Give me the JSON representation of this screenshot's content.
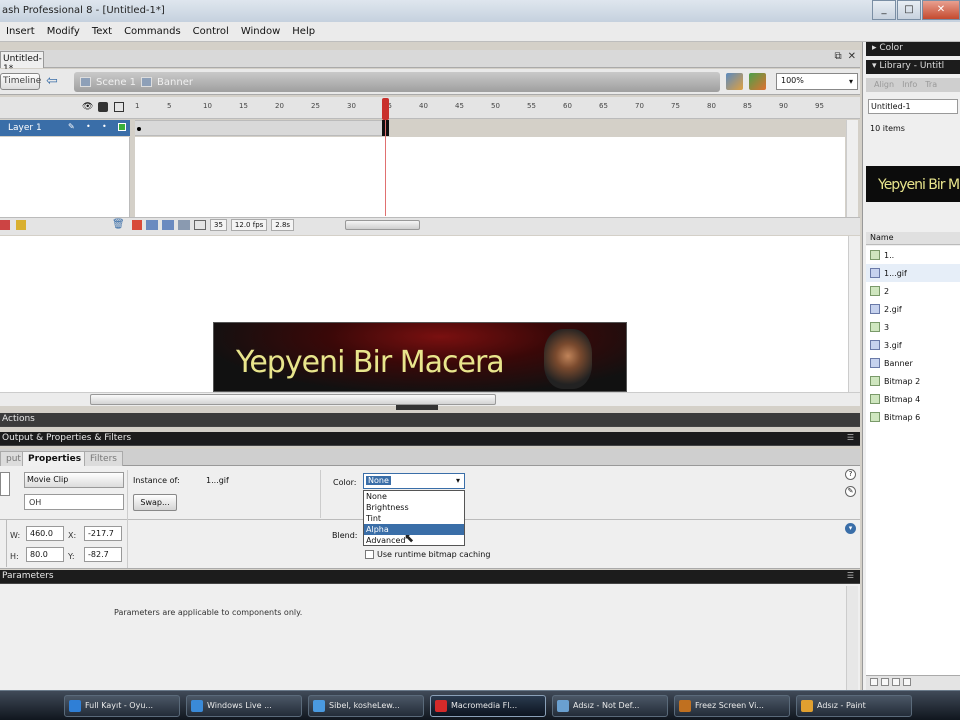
{
  "window": {
    "title": "ash Professional 8 - [Untitled-1*]"
  },
  "menu": [
    "Insert",
    "Modify",
    "Text",
    "Commands",
    "Control",
    "Window",
    "Help"
  ],
  "document": {
    "tab": "Untitled-1*",
    "timeline_button": "Timeline",
    "breadcrumb": [
      "Scene 1",
      "Banner"
    ],
    "zoom": "100%"
  },
  "timeline": {
    "ruler": [
      "1",
      "5",
      "10",
      "15",
      "20",
      "25",
      "30",
      "35",
      "40",
      "45",
      "50",
      "55",
      "60",
      "65",
      "70",
      "75",
      "80",
      "85",
      "90",
      "95"
    ],
    "layer": "Layer 1",
    "current_frame": "35",
    "frame_rate": "12.0 fps",
    "elapsed": "2.8s"
  },
  "stage": {
    "banner_text": "Yepyeni Bir Macera"
  },
  "panels": {
    "actions": "Actions",
    "properties_group": "Output & Properties & Filters",
    "parameters": "Parameters"
  },
  "properties": {
    "tabs": [
      "put",
      "Properties",
      "Filters"
    ],
    "symbol_type": "Movie Clip",
    "instance_name": "OH",
    "instance_of_label": "Instance of:",
    "instance_of_value": "1...gif",
    "swap_label": "Swap...",
    "w_label": "W:",
    "w": "460.0",
    "h_label": "H:",
    "h": "80.0",
    "x_label": "X:",
    "x": "-217.7",
    "y_label": "Y:",
    "y": "-82.7",
    "color_label": "Color:",
    "color_value": "None",
    "color_options": [
      "None",
      "Brightness",
      "Tint",
      "Alpha",
      "Advanced"
    ],
    "color_selected_index": 3,
    "blend_label": "Blend:",
    "cache_label": "Use runtime bitmap caching"
  },
  "parameters": {
    "message": "Parameters are applicable to components only."
  },
  "right_panel": {
    "color_title": "Color",
    "library_title": "Library - Untitl",
    "tabs": [
      "Align",
      "Info",
      "Tra"
    ],
    "document": "Untitled-1",
    "count": "10 items",
    "preview_text": "Yepyeni Bir Ma",
    "name_header": "Name",
    "items": [
      {
        "name": "1..",
        "kind": "symbol"
      },
      {
        "name": "1...gif",
        "kind": "bitmap"
      },
      {
        "name": "2",
        "kind": "symbol"
      },
      {
        "name": "2.gif",
        "kind": "bitmap"
      },
      {
        "name": "3",
        "kind": "symbol"
      },
      {
        "name": "3.gif",
        "kind": "bitmap"
      },
      {
        "name": "Banner",
        "kind": "bitmap"
      },
      {
        "name": "Bitmap 2",
        "kind": "symbol"
      },
      {
        "name": "Bitmap 4",
        "kind": "symbol"
      },
      {
        "name": "Bitmap 6",
        "kind": "symbol"
      }
    ]
  },
  "taskbar": [
    {
      "label": "Full Kayıt - Oyu...",
      "color": "#2f7fd6"
    },
    {
      "label": "Windows Live ...",
      "color": "#3a8ad8"
    },
    {
      "label": "Sibel, kosheLew...",
      "color": "#4a9ae0"
    },
    {
      "label": "Macromedia Fl...",
      "color": "#d42a2a"
    },
    {
      "label": "Adsız - Not Def...",
      "color": "#6aa0d0"
    },
    {
      "label": "Freez Screen Vi...",
      "color": "#c07020"
    },
    {
      "label": "Adsız - Paint",
      "color": "#e0a030"
    }
  ],
  "colors": {
    "accent": "#3a6ea8",
    "banner_text": "#e8e58c",
    "playhead": "#c9302c"
  }
}
